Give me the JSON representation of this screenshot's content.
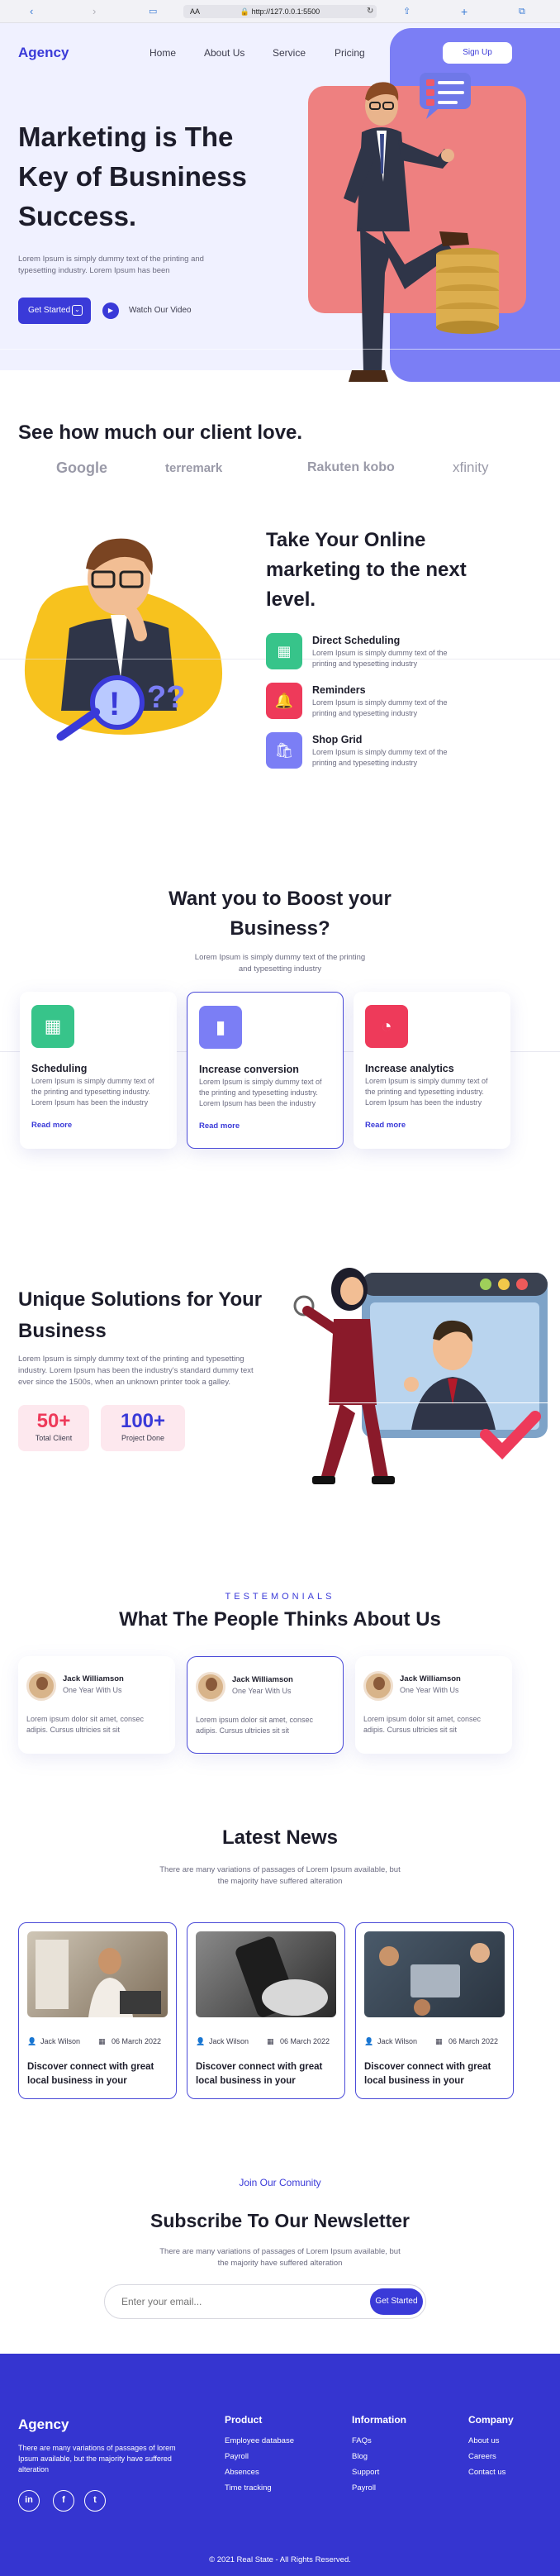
{
  "browser": {
    "url": "http://127.0.0.1:5500",
    "aa": "AA"
  },
  "header": {
    "logo": "Agency",
    "nav": [
      "Home",
      "About Us",
      "Service",
      "Pricing"
    ],
    "signup": "Sign Up"
  },
  "hero": {
    "title": "Marketing is The Key of Busniness Success.",
    "text": "Lorem Ipsum is simply dummy text of the printing and typesetting industry. Lorem Ipsum has been",
    "cta": "Get Started",
    "watch": "Watch Our Video"
  },
  "clients": {
    "title": "See how much our client love.",
    "logos": [
      "Google",
      "terremark",
      "Rakuten kobo",
      "xfinity"
    ]
  },
  "marketing": {
    "title": "Take Your Online marketing to the next level.",
    "features": [
      {
        "title": "Direct Scheduling",
        "desc": "Lorem Ipsum is simply dummy text of the printing and typesetting industry"
      },
      {
        "title": "Reminders",
        "desc": "Lorem Ipsum is simply dummy text of the printing and typesetting industry"
      },
      {
        "title": "Shop Grid",
        "desc": "Lorem Ipsum is simply dummy text of the printing and typesetting industry"
      }
    ]
  },
  "boost": {
    "title": "Want you to Boost your Business?",
    "sub": "Lorem Ipsum is simply dummy text of the printing and typesetting industry",
    "cards": [
      {
        "title": "Scheduling",
        "desc": "Lorem Ipsum is simply dummy text of the printing and typesetting industry. Lorem Ipsum has been the industry",
        "more": "Read more"
      },
      {
        "title": "Increase conversion",
        "desc": "Lorem Ipsum is simply dummy text of the printing and typesetting industry. Lorem Ipsum has been the industry",
        "more": "Read more"
      },
      {
        "title": "Increase analytics",
        "desc": "Lorem Ipsum is simply dummy text of the printing and typesetting industry. Lorem Ipsum has been the industry",
        "more": "Read more"
      }
    ]
  },
  "unique": {
    "title": "Unique Solutions for Your Business",
    "text": "Lorem Ipsum is simply dummy text of the printing and typesetting industry. Lorem Ipsum has been the industry's standard dummy text ever since the 1500s, when an unknown printer took a galley.",
    "stats": [
      {
        "value": "50+",
        "label": "Total Client",
        "color": "#ee3a5a"
      },
      {
        "value": "100+",
        "label": "Project Done",
        "color": "#3a3ad8"
      }
    ]
  },
  "testimonials": {
    "eyebrow": "TESTEMONIALS",
    "title": "What The People Thinks About Us",
    "items": [
      {
        "name": "Jack Williamson",
        "role": "One Year With Us",
        "quote": "Lorem ipsum dolor sit amet, consec adipis. Cursus ultricies sit sit"
      },
      {
        "name": "Jack Williamson",
        "role": "One Year With Us",
        "quote": "Lorem ipsum dolor sit amet, consec adipis. Cursus ultricies sit sit"
      },
      {
        "name": "Jack Williamson",
        "role": "One Year With Us",
        "quote": "Lorem ipsum dolor sit amet, consec adipis. Cursus ultricies sit sit"
      }
    ]
  },
  "news": {
    "title": "Latest News",
    "sub": "There are many variations of passages of Lorem Ipsum available, but the majority have suffered alteration",
    "items": [
      {
        "author": "Jack Wilson",
        "date": "06 March 2022",
        "title": "Discover connect with great local business in your"
      },
      {
        "author": "Jack Wilson",
        "date": "06 March 2022",
        "title": "Discover connect with great local business in your"
      },
      {
        "author": "Jack Wilson",
        "date": "06 March 2022",
        "title": "Discover connect with great local business in your"
      }
    ]
  },
  "newsletter": {
    "eyebrow": "Join Our Comunity",
    "title": "Subscribe To Our Newsletter",
    "sub": "There are many variations of passages of Lorem Ipsum available, but the majority have suffered alteration",
    "placeholder": "Enter your email...",
    "button": "Get Started"
  },
  "footer": {
    "logo": "Agency",
    "text": "There are many variations of passages of lorem Ipsum available, but the majority have suffered alteration",
    "social": [
      "in",
      "f",
      "t"
    ],
    "cols": [
      {
        "title": "Product",
        "links": [
          "Employee database",
          "Payroll",
          "Absences",
          "Time tracking"
        ]
      },
      {
        "title": "Information",
        "links": [
          "FAQs",
          "Blog",
          "Support",
          "Payroll"
        ]
      },
      {
        "title": "Company",
        "links": [
          "About us",
          "Careers",
          "Contact us"
        ]
      }
    ],
    "copyright": "© 2021 Real State - All Rights Reserved."
  },
  "colors": {
    "primary": "#3a3ad8",
    "hero_bg": "#f0f1ff",
    "accent_pink": "#ee8080",
    "accent_purple": "#7b7ef5"
  }
}
